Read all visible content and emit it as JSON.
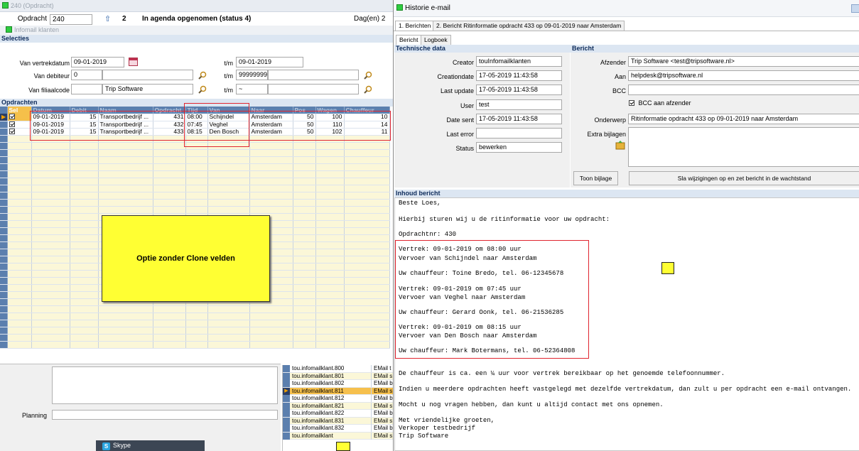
{
  "left": {
    "window_title": "240 (Opdracht)",
    "opdracht_label": "Opdracht",
    "opdracht_value": "240",
    "opdracht_nr": "2",
    "status_text": "In agenda opgenomen (status 4)",
    "dagen": "Dag(en) 2",
    "subtitle": "Infomail klanten",
    "selecties_header": "Selecties",
    "van_vertrekdatum_label": "Van vertrekdatum",
    "van_vertrekdatum": "09-01-2019",
    "tm_label": "t/m",
    "tm_vertrekdatum": "09-01-2019",
    "van_debiteur_label": "Van debiteur",
    "van_debiteur": "0",
    "tm_debiteur": "999999999",
    "van_filiaalcode_label": "Van filiaalcode",
    "van_filiaalcode_name": "Trip Software",
    "tm_filiaalcode": "~",
    "opdrachten_header": "Opdrachten",
    "columns": [
      "Sel",
      "Datum",
      "Debit",
      "Naam",
      "Opdracht",
      "Tijd",
      "Van",
      "Naar",
      "Pos",
      "Wagen",
      "Chauffeur"
    ],
    "rows": [
      {
        "datum": "09-01-2019",
        "debit": "15",
        "naam": "Transportbedrijf ...",
        "opdracht": "431",
        "tijd": "08:00",
        "van": "Schijndel",
        "naar": "Amsterdam",
        "pos": "50",
        "wagen": "100",
        "chauffeur": "10"
      },
      {
        "datum": "09-01-2019",
        "debit": "15",
        "naam": "Transportbedrijf ...",
        "opdracht": "432",
        "tijd": "07:45",
        "van": "Veghel",
        "naar": "Amsterdam",
        "pos": "50",
        "wagen": "110",
        "chauffeur": "14"
      },
      {
        "datum": "09-01-2019",
        "debit": "15",
        "naam": "Transportbedrijf ...",
        "opdracht": "433",
        "tijd": "08:15",
        "van": "Den Bosch",
        "naar": "Amsterdam",
        "pos": "50",
        "wagen": "102",
        "chauffeur": "11"
      }
    ],
    "note_text": "Optie zonder Clone velden",
    "planning_label": "Planning",
    "skype_label": "Skype",
    "mail_list": [
      {
        "name": "tou.infomailklant.800",
        "type": "EMail t"
      },
      {
        "name": "tou.infomailklant.801",
        "type": "EMail s"
      },
      {
        "name": "tou.infomailklant.802",
        "type": "EMail b"
      },
      {
        "name": "tou.infomailklant.811",
        "type": "EMail s"
      },
      {
        "name": "tou.infomailklant.812",
        "type": "EMail b"
      },
      {
        "name": "tou.infomailklant.821",
        "type": "EMail s"
      },
      {
        "name": "tou.infomailklant.822",
        "type": "EMail b"
      },
      {
        "name": "tou.infomailklant.831",
        "type": "EMail s"
      },
      {
        "name": "tou.infomailklant.832",
        "type": "EMail b"
      },
      {
        "name": "tou.infomailklant",
        "type": "EMail s"
      }
    ]
  },
  "right": {
    "window_title": "Historie e-mail",
    "tab1": "1. Berichten",
    "tab2": "2. Bericht Ritinformatie opdracht 433 op 09-01-2019 naar Amsterdam",
    "subtab1": "Bericht",
    "subtab2": "Logboek",
    "technische_data": "Technische data",
    "bericht_header": "Bericht",
    "creator_label": "Creator",
    "creator": "touInfomailklanten",
    "creationdate_label": "Creationdate",
    "creationdate": "17-05-2019 11:43:58",
    "lastupdate_label": "Last update",
    "lastupdate": "17-05-2019 11:43:58",
    "user_label": "User",
    "user": "test",
    "datesent_label": "Date sent",
    "datesent": "17-05-2019 11:43:58",
    "lasterror_label": "Last error",
    "lasterror": "",
    "status_label": "Status",
    "status": "bewerken",
    "afzender_label": "Afzender",
    "afzender": "Trip Software <test@tripsoftware.nl>",
    "aan_label": "Aan",
    "aan": "helpdesk@tripsoftware.nl",
    "bcc_label": "BCC",
    "bcc": "",
    "bcc_afzender": "BCC aan afzender",
    "onderwerp_label": "Onderwerp",
    "onderwerp": "Ritinformatie opdracht 433 op 09-01-2019 naar Amsterdam",
    "extra_bijlagen_label": "Extra bijlagen",
    "toon_bijlage": "Toon bijlage",
    "sla_op": "Sla wijzigingen op en zet bericht in de wachtstand",
    "inhoud_header": "Inhoud bericht",
    "message": {
      "l1": "Beste Loes,",
      "l2": "Hierbij sturen wij u de ritinformatie voor uw opdracht:",
      "l3": "Opdrachtnr: 430",
      "l4": "Vertrek: 09-01-2019 om 08:00 uur",
      "l5": "Vervoer van Schijndel naar Amsterdam",
      "l6": "Uw chauffeur: Toine Bredo, tel. 06-12345678",
      "l7": "Vertrek: 09-01-2019 om 07:45 uur",
      "l8": "Vervoer van Veghel naar Amsterdam",
      "l9": "Uw chauffeur: Gerard Oonk, tel. 06-21536285",
      "l10": "Vertrek: 09-01-2019 om 08:15 uur",
      "l11": "Vervoer van Den Bosch naar Amsterdam",
      "l12": "Uw chauffeur: Mark Botermans, tel. 06-52364808",
      "l13": "De chauffeur is ca. een ¼ uur voor vertrek bereikbaar op het genoemde telefoonnummer.",
      "l14": "Indien u meerdere opdrachten heeft vastgelegd met dezelfde vertrekdatum, dan zult u per opdracht een e-mail ontvangen.",
      "l15": "Mocht u nog vragen hebben, dan kunt u altijd contact met ons opnemen.",
      "l16": "Met vriendelijke groeten,",
      "l17": "Verkoper testbedrijf",
      "l18": "Trip Software"
    }
  },
  "colors": {
    "accent_red": "#e0252f",
    "note_yellow": "#ffff33",
    "header_blue": "#5b7fae",
    "row_yellow": "#fbf7d8"
  }
}
